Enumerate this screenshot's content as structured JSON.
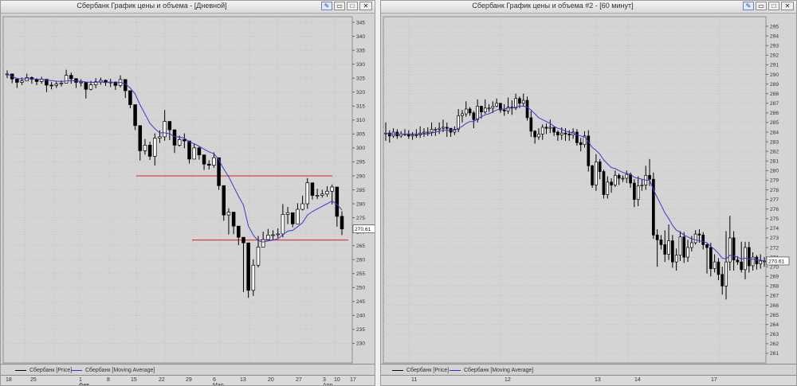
{
  "windows": [
    {
      "title": "Сбербанк График цены и объема - [Дневной]",
      "legend": [
        {
          "label": "Сбербанк [Price]",
          "color": "#000000"
        },
        {
          "label": "Сбербанк [Moving Average]",
          "color": "#3333cc"
        }
      ],
      "dates": [
        "18",
        "25",
        "1",
        "8",
        "15",
        "22",
        "29",
        "6",
        "13",
        "20",
        "27",
        "3",
        "10",
        "17"
      ],
      "dates_row2": [
        "",
        "",
        "Фев",
        "",
        "",
        "",
        "",
        "Мар",
        "",
        "",
        "",
        "Апр",
        "",
        ""
      ]
    },
    {
      "title": "Сбербанк График цены и объема #2 - [60 минут]",
      "legend": [
        {
          "label": "Сбербанк [Price]",
          "color": "#000000"
        },
        {
          "label": "Сбербанк [Moving Average]",
          "color": "#3333cc"
        }
      ],
      "dates": [
        "11",
        "12",
        "13",
        "14",
        "17"
      ],
      "dates_row2": [
        "",
        "",
        "",
        "",
        ""
      ]
    }
  ],
  "chart_data": [
    {
      "type": "candlestick",
      "title": "Сбербанк График цены и объема - [Дневной]",
      "ylim": [
        223,
        347
      ],
      "yticks": [
        230,
        235,
        240,
        245,
        250,
        255,
        260,
        265,
        270,
        275,
        280,
        285,
        290,
        295,
        300,
        305,
        310,
        315,
        320,
        325,
        330,
        335,
        340,
        345
      ],
      "xlabels": [
        "18",
        "25",
        "1",
        "8",
        "15",
        "22",
        "29",
        "6",
        "13",
        "20",
        "27",
        "3",
        "10",
        "17"
      ],
      "last_value": "270.61",
      "close": [
        326.5,
        324.7,
        323.5,
        324.0,
        325.2,
        324.6,
        323.8,
        324.6,
        322.5,
        322.4,
        322.9,
        323.2,
        326.0,
        324.8,
        323.5,
        323.6,
        321.0,
        322.6,
        323.7,
        324.2,
        323.4,
        323.6,
        322.4,
        324.5,
        320.5,
        315.5,
        308.0,
        299.0,
        301.0,
        297.0,
        303.5,
        304.0,
        309.5,
        306.5,
        301.0,
        303.0,
        302.5,
        296.0,
        300.0,
        297.5,
        294.2,
        293.8,
        296.5,
        286.5,
        276.0,
        277.0,
        272.0,
        268.0,
        266.0,
        249.0,
        258.0,
        264.5,
        267.2,
        268.8,
        268.9,
        269.2,
        276.2,
        276.8,
        272.8,
        278.0,
        280.0,
        287.5,
        283.0,
        283.0,
        283.5,
        284.5,
        286.0,
        275.5,
        271.0
      ],
      "high": [
        327.8,
        326.0,
        324.5,
        325.2,
        326.6,
        325.6,
        325.0,
        325.5,
        324.5,
        323.6,
        324.0,
        324.2,
        328.0,
        327.0,
        325.0,
        324.6,
        322.8,
        324.0,
        325.0,
        325.2,
        324.5,
        324.8,
        323.8,
        326.0,
        322.5,
        319.2,
        311.5,
        303.0,
        303.2,
        302.2,
        305.2,
        306.3,
        313.6,
        309.2,
        305.4,
        304.4,
        305.2,
        298.7,
        301.6,
        300.4,
        295.6,
        295.6,
        298.4,
        292.6,
        284.7,
        278.4,
        277.1,
        270.7,
        266.3,
        259.6,
        260.1,
        268.5,
        270.0,
        271.0,
        270.5,
        271.2,
        279.9,
        278.9,
        276.6,
        280.2,
        282.9,
        289.2,
        286.2,
        285.4,
        285.0,
        286.3,
        286.9,
        285.5,
        277.3
      ],
      "low": [
        325.0,
        323.2,
        321.5,
        322.5,
        324.0,
        323.0,
        322.5,
        323.0,
        320.0,
        321.0,
        321.5,
        322.0,
        323.5,
        323.0,
        321.5,
        322.0,
        317.7,
        320.6,
        321.4,
        322.6,
        322.2,
        321.8,
        320.8,
        321.7,
        317.9,
        314.2,
        306.4,
        295.5,
        297.6,
        295.7,
        293.7,
        301.8,
        302.6,
        302.8,
        298.2,
        300.5,
        299.9,
        294.4,
        296.0,
        295.8,
        292.1,
        292.3,
        292.9,
        285.0,
        273.9,
        269.0,
        269.1,
        265.2,
        248.4,
        246.3,
        247.0,
        257.2,
        264.9,
        267.5,
        267.1,
        267.7,
        268.0,
        272.7,
        271.6,
        276.1,
        277.6,
        278.2,
        281.5,
        281.7,
        282.2,
        282.5,
        279.8,
        271.8,
        268.8
      ],
      "moving_average": [
        326.5,
        325.6,
        324.9,
        324.7,
        324.8,
        324.8,
        324.6,
        324.6,
        324.3,
        324.1,
        323.9,
        323.8,
        324.0,
        324.1,
        324.0,
        323.9,
        323.6,
        323.5,
        323.5,
        323.6,
        323.5,
        323.5,
        323.3,
        323.5,
        322.9,
        321.5,
        319.3,
        315.4,
        312.2,
        308.8,
        306.9,
        305.4,
        305.4,
        305.1,
        304.1,
        303.9,
        303.5,
        302.2,
        301.5,
        300.6,
        299.5,
        298.6,
        297.9,
        295.8,
        292.4,
        289.7,
        286.2,
        282.7,
        279.5,
        272.1,
        268.8,
        266.7,
        266.3,
        266.7,
        267.0,
        267.4,
        268.9,
        270.2,
        270.5,
        271.8,
        273.2,
        276.0,
        277.2,
        278.2,
        279.1,
        280.0,
        281.0,
        279.8,
        277.8
      ]
    },
    {
      "type": "candlestick",
      "title": "Сбербанк График цены и объема #2 - [60 минут]",
      "ylim": [
        260,
        296
      ],
      "yticks": [
        261,
        262,
        263,
        264,
        265,
        266,
        267,
        268,
        269,
        270,
        271,
        272,
        273,
        274,
        275,
        276,
        277,
        278,
        279,
        280,
        281,
        282,
        283,
        284,
        285,
        286,
        287,
        288,
        289,
        290,
        291,
        292,
        293,
        294,
        295
      ],
      "xlabels": [
        "11",
        "12",
        "13",
        "14",
        "17"
      ],
      "last_value": "270.61",
      "close": [
        283.9,
        283.6,
        284.0,
        283.6,
        283.8,
        283.8,
        283.6,
        283.7,
        283.7,
        283.9,
        284.0,
        284.0,
        284.3,
        284.3,
        284.4,
        284.5,
        284.4,
        284.0,
        284.3,
        285.7,
        285.9,
        286.4,
        286.0,
        285.3,
        286.7,
        286.1,
        286.5,
        286.5,
        286.7,
        287.0,
        286.3,
        286.2,
        286.6,
        286.5,
        287.5,
        287.0,
        287.3,
        285.5,
        284.1,
        283.5,
        283.8,
        284.5,
        284.4,
        284.5,
        284.0,
        283.7,
        283.9,
        283.8,
        283.7,
        284.0,
        282.9,
        282.7,
        283.6,
        280.5,
        278.5,
        280.9,
        279.9,
        277.5,
        278.8,
        278.5,
        279.5,
        279.2,
        279.2,
        279.6,
        278.7,
        277.0,
        278.4,
        278.5,
        279.5,
        279.1,
        273.3,
        272.8,
        272.3,
        271.3,
        272.7,
        270.5,
        271.2,
        273.1,
        271.0,
        272.0,
        272.5,
        273.4,
        273.3,
        272.3,
        272.0,
        269.8,
        270.5,
        269.2,
        268.0,
        270.5,
        273.0,
        270.7,
        270.5,
        269.7,
        272.0,
        270.1,
        271.0,
        270.3,
        270.6,
        270.6
      ],
      "high": [
        285.0,
        284.2,
        284.4,
        284.3,
        284.1,
        284.3,
        284.2,
        284.0,
        284.3,
        284.6,
        284.4,
        284.5,
        285.0,
        284.5,
        285.0,
        285.3,
        285.0,
        284.4,
        284.6,
        286.4,
        286.3,
        287.2,
        286.6,
        286.2,
        287.4,
        286.6,
        287.4,
        286.9,
        287.2,
        287.5,
        286.9,
        286.9,
        287.6,
        287.3,
        288.0,
        287.7,
        288.0,
        287.7,
        286.2,
        284.2,
        284.4,
        284.8,
        284.9,
        285.3,
        284.4,
        284.2,
        284.5,
        284.4,
        284.2,
        284.4,
        284.3,
        283.4,
        284.1,
        284.2,
        280.6,
        281.7,
        281.2,
        280.1,
        279.4,
        279.2,
        280.0,
        279.7,
        279.5,
        280.0,
        279.8,
        279.1,
        279.4,
        279.1,
        280.5,
        281.2,
        279.8,
        273.9,
        273.3,
        273.8,
        274.4,
        273.3,
        271.9,
        273.7,
        273.6,
        272.8,
        273.2,
        273.8,
        273.9,
        273.6,
        272.4,
        272.5,
        271.3,
        270.9,
        270.0,
        273.7,
        275.3,
        273.7,
        271.1,
        272.6,
        272.6,
        272.6,
        271.5,
        271.2,
        271.3,
        271.0
      ],
      "low": [
        283.1,
        282.9,
        283.4,
        283.3,
        283.4,
        283.6,
        283.3,
        283.2,
        283.4,
        283.4,
        283.5,
        283.6,
        283.6,
        283.6,
        283.8,
        284.0,
        283.5,
        283.5,
        283.7,
        284.0,
        285.0,
        285.6,
        285.7,
        284.4,
        285.0,
        285.4,
        285.9,
        286.1,
        286.0,
        286.6,
        286.0,
        285.7,
        285.9,
        285.8,
        286.3,
        286.5,
        286.7,
        285.2,
        283.5,
        282.8,
        283.2,
        283.2,
        283.8,
        283.9,
        283.6,
        283.1,
        283.2,
        283.1,
        283.1,
        283.3,
        282.6,
        282.0,
        282.4,
        279.9,
        278.2,
        277.9,
        279.1,
        277.1,
        277.1,
        277.7,
        278.3,
        278.5,
        278.8,
        278.7,
        278.2,
        276.2,
        276.3,
        277.9,
        278.0,
        278.4,
        272.9,
        270.0,
        271.8,
        270.5,
        270.7,
        269.9,
        269.6,
        270.6,
        270.4,
        270.5,
        271.6,
        272.3,
        272.5,
        271.8,
        269.3,
        269.0,
        269.4,
        268.6,
        267.1,
        266.6,
        269.6,
        269.6,
        270.2,
        269.4,
        268.7,
        269.4,
        269.6,
        269.7,
        269.8,
        270.0
      ],
      "moving_average": [
        283.9,
        283.8,
        283.8,
        283.8,
        283.8,
        283.8,
        283.8,
        283.8,
        283.8,
        283.8,
        283.8,
        283.8,
        283.9,
        284.0,
        284.1,
        284.2,
        284.2,
        284.2,
        284.2,
        284.4,
        284.6,
        284.9,
        285.1,
        285.1,
        285.4,
        285.6,
        285.8,
        285.9,
        286.1,
        286.3,
        286.4,
        286.4,
        286.5,
        286.5,
        286.6,
        286.7,
        286.7,
        286.6,
        286.3,
        285.9,
        285.5,
        285.3,
        285.1,
        284.9,
        284.6,
        284.4,
        284.3,
        284.1,
        284.0,
        283.9,
        283.7,
        283.6,
        283.5,
        283.0,
        282.4,
        282.1,
        281.7,
        281.1,
        280.7,
        280.3,
        280.2,
        280.0,
        279.8,
        279.7,
        279.6,
        279.3,
        279.2,
        279.1,
        279.0,
        279.0,
        278.0,
        277.2,
        276.4,
        275.6,
        275.0,
        274.3,
        273.8,
        273.6,
        273.3,
        273.1,
        272.9,
        272.8,
        272.7,
        272.6,
        272.5,
        272.1,
        271.8,
        271.4,
        270.9,
        270.8,
        271.2,
        271.1,
        271.0,
        270.8,
        270.9,
        270.8,
        270.8,
        270.7,
        270.7,
        270.6
      ]
    }
  ]
}
